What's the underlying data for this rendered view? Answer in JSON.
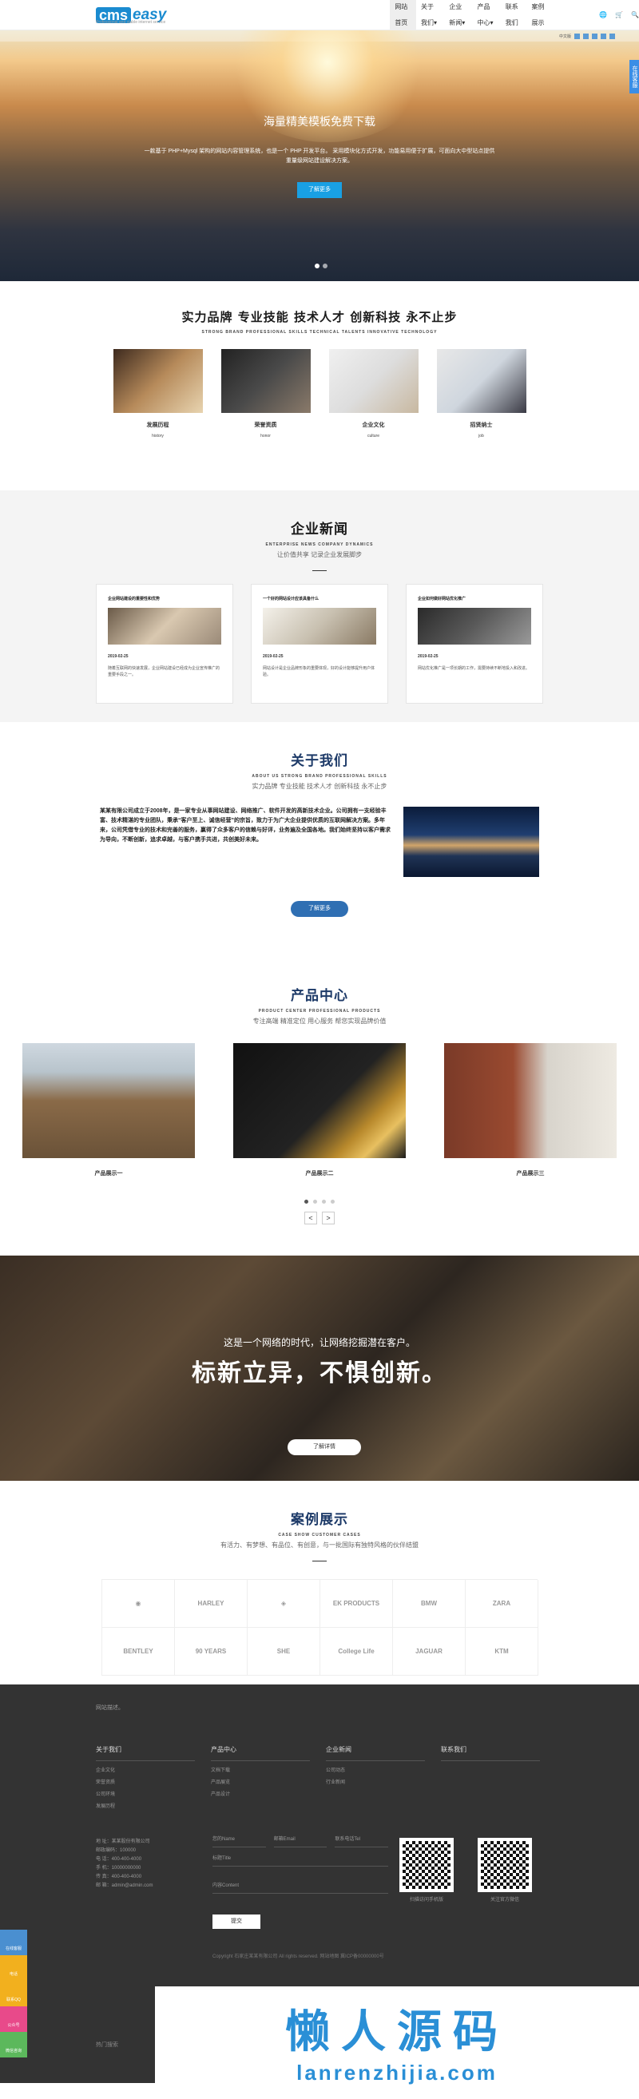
{
  "nav": {
    "logo_box": "cms",
    "logo_text": "easy",
    "logo_sub": "Professional and stable internet service",
    "menu": [
      "网站首页",
      "关于我们▾",
      "企业新闻▾",
      "产品中心▾",
      "联系我们",
      "案例展示"
    ],
    "icons": [
      "🌐",
      "🛒",
      "🔍"
    ]
  },
  "hero": {
    "title": "海量精美模板免费下载",
    "desc": "一款基于 PHP+Mysql 架构的网站内容管理系统，也是一个 PHP 开发平台。 采用模块化方式开发，功能易用便于扩展，可面向大中型站点提供重量级网站建设解决方案。",
    "button": "了解更多",
    "side_tab": "在线客服",
    "bar_label": "中文版"
  },
  "s1": {
    "title": "实力品牌 专业技能 技术人才 创新科技 永不止步",
    "en": "STRONG BRAND PROFESSIONAL SKILLS TECHNICAL TALENTS INNOVATIVE TECHNOLOGY",
    "cards": [
      {
        "t": "发展历程",
        "e": "history"
      },
      {
        "t": "荣誉资质",
        "e": "honor"
      },
      {
        "t": "企业文化",
        "e": "culture"
      },
      {
        "t": "招贤纳士",
        "e": "job"
      }
    ]
  },
  "s2": {
    "title": "企业新闻",
    "en": "ENTERPRISE NEWS COMPANY DYNAMICS",
    "sub": "让价值共享 记录企业发展脚步",
    "news": [
      {
        "t": "企业网站建设的重要性和优势",
        "d": "2019-02-25",
        "x": "随着互联网的快速发展，企业网站建设已经成为企业宣传推广的重要手段之一。"
      },
      {
        "t": "一个好的网站设计应该具备什么",
        "d": "2019-02-25",
        "x": "网站设计是企业品牌形象的重要体现，好的设计能够提升用户体验。"
      },
      {
        "t": "企业如何做好网站优化推广",
        "d": "2019-02-25",
        "x": "网站优化推广是一项长期的工作，需要持续不断地投入和改进。"
      }
    ]
  },
  "s3": {
    "title": "关于我们",
    "en": "ABOUT US STRONG BRAND PROFESSIONAL SKILLS",
    "sub": "实力品牌 专业技能 技术人才 创新科技 永不止步",
    "text": "某某有限公司成立于2008年，是一家专业从事网站建设、网络推广、软件开发的高新技术企业。公司拥有一支经验丰富、技术精湛的专业团队，秉承“客户至上、诚信经营”的宗旨，致力于为广大企业提供优质的互联网解决方案。多年来，公司凭借专业的技术和完善的服务，赢得了众多客户的信赖与好评，业务遍及全国各地。我们始终坚持以客户需求为导向，不断创新，追求卓越，与客户携手共进，共创美好未来。",
    "button": "了解更多"
  },
  "s4": {
    "title": "产品中心",
    "en": "PRODUCT CENTER PROFESSIONAL PRODUCTS",
    "sub": "专注高端 精准定位 用心服务 帮您实现品牌价值",
    "products": [
      "产品展示一",
      "产品展示二",
      "产品展示三"
    ],
    "arrow_prev": "<",
    "arrow_next": ">"
  },
  "banner": {
    "small": "这是一个网络的时代，让网络挖掘潜在客户。",
    "big": "标新立异，不惧创新。",
    "button": "了解详情"
  },
  "s5": {
    "title": "案例展示",
    "en": "CASE SHOW CUSTOMER CASES",
    "sub": "有活力、有梦想、有品位、有创意，与一批国际有独特风格的伙伴结盟",
    "logos": [
      "◉",
      "HARLEY",
      "◈",
      "EK PRODUCTS",
      "BMW",
      "ZARA",
      "BENTLEY",
      "90 YEARS",
      "SHE",
      "College Life",
      "JAGUAR",
      "KTM"
    ]
  },
  "footer": {
    "top": "网站描述。",
    "cols": [
      {
        "h": "关于我们",
        "items": [
          "企业文化",
          "荣誉资质",
          "公司环境",
          "发展历程"
        ]
      },
      {
        "h": "产品中心",
        "items": [
          "文档下载",
          "产品展览",
          "产品设计"
        ]
      },
      {
        "h": "企业新闻",
        "items": [
          "公司动态",
          "行业新闻"
        ]
      },
      {
        "h": "联系我们",
        "items": []
      }
    ],
    "contact": [
      "地 址：某某股份有限公司",
      "邮政编码：100000",
      "电 话：400-400-4000",
      "手 机：10000000000",
      "传 真：400-400-4000",
      "邮 箱：admin@admin.com"
    ],
    "form": {
      "name": "您的Name",
      "email": "邮箱Email",
      "tel": "联系电话Tel",
      "title": "标题Title",
      "content": "内容Content",
      "submit": "提交"
    },
    "qr1": "扫描访问手机版",
    "qr2": "关注官方微信",
    "copy": "Copyright 石家庄某某有限公司 All rights reserved. 网站地图  冀ICP备00000000号"
  },
  "brand": {
    "cn": "懒人源码",
    "en": "lanrenzhijia.com"
  },
  "left_tabs": [
    "在线客服",
    "电话",
    "联系QQ",
    "公众号",
    "微信咨询"
  ],
  "bottom": "热门搜索"
}
